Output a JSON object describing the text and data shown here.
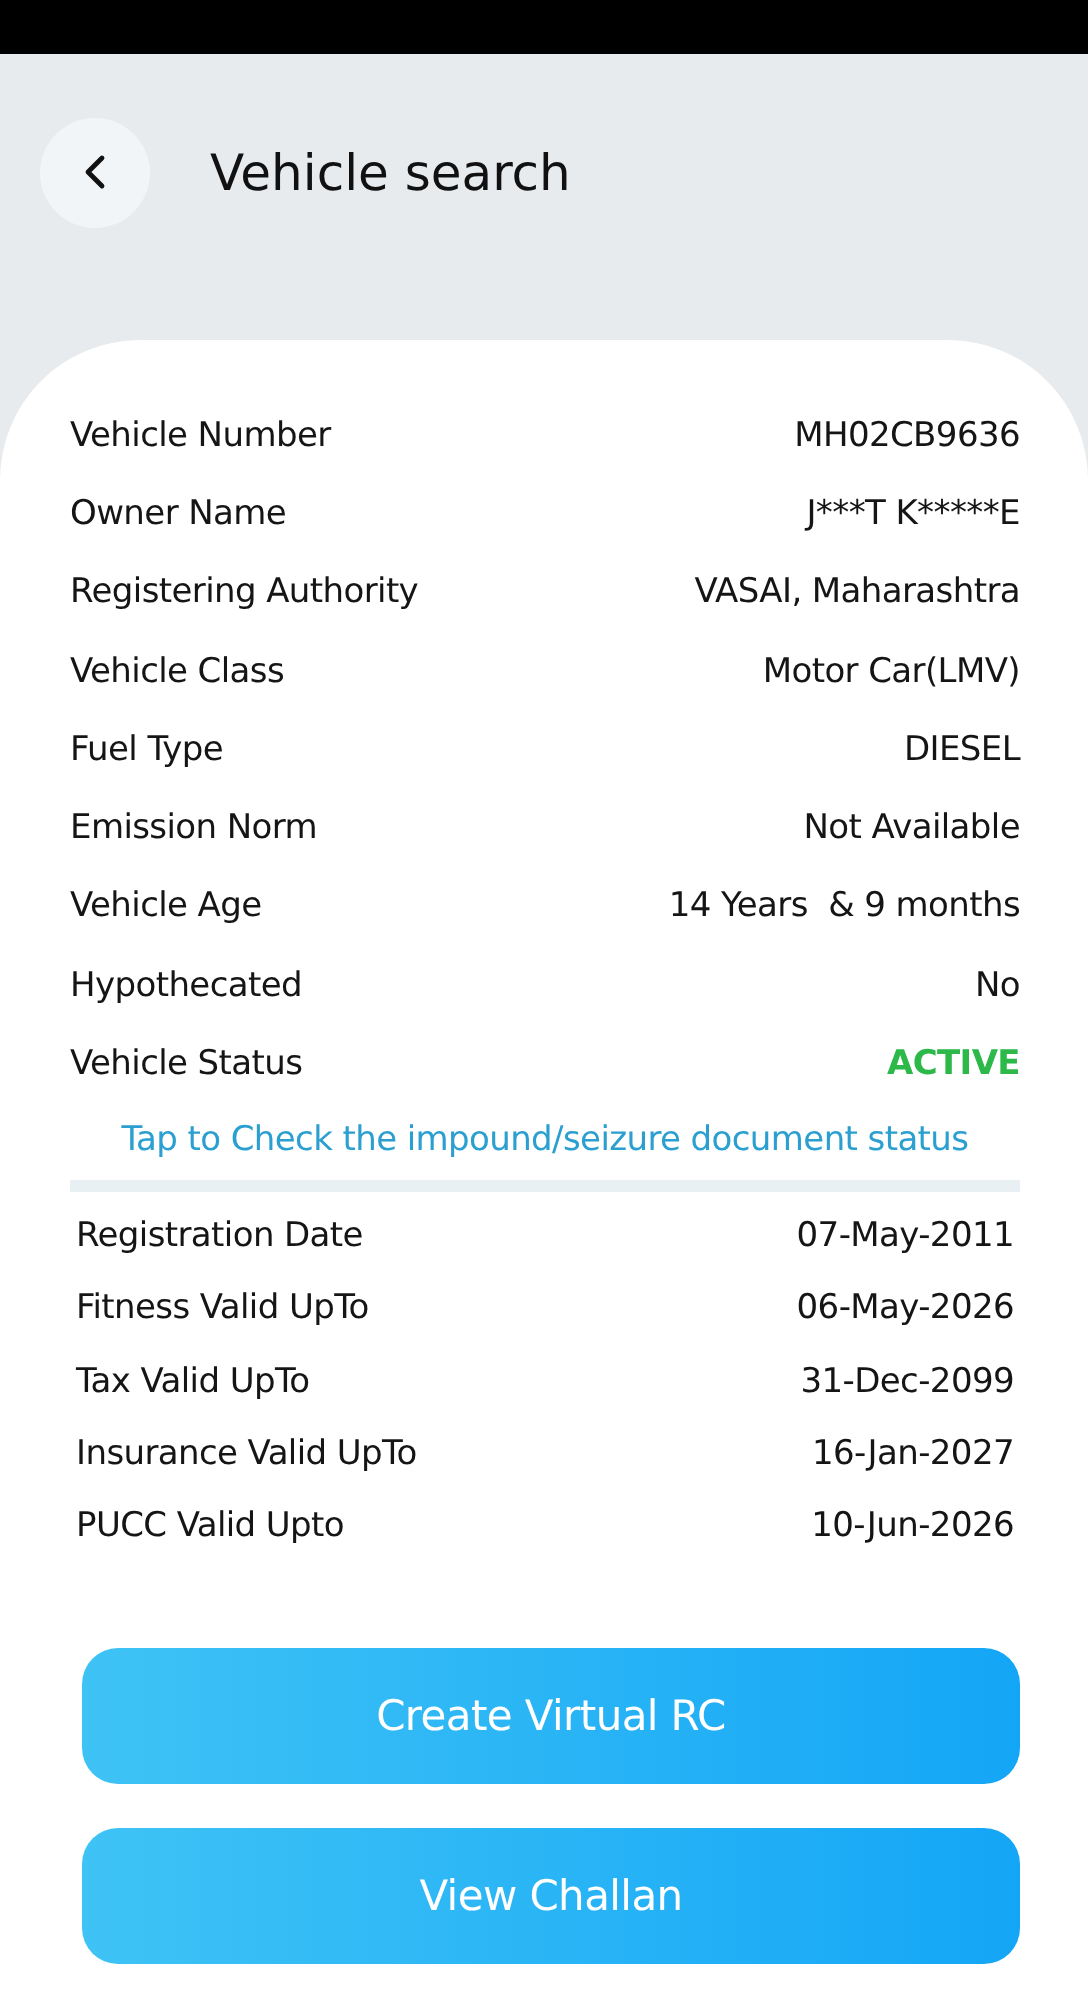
{
  "header": {
    "title": "Vehicle search"
  },
  "details": [
    {
      "label": "Vehicle Number",
      "value": "MH02CB9636"
    },
    {
      "label": "Owner Name",
      "value": "J***T K*****E"
    },
    {
      "label": "Registering Authority",
      "value": "VASAI, Maharashtra"
    },
    {
      "label": "Vehicle Class",
      "value": "Motor Car(LMV)"
    },
    {
      "label": "Fuel Type",
      "value": "DIESEL"
    },
    {
      "label": "Emission Norm",
      "value": "Not Available"
    },
    {
      "label": "Vehicle Age",
      "value": "14 Years  & 9 months"
    },
    {
      "label": "Hypothecated",
      "value": "No"
    },
    {
      "label": "Vehicle Status",
      "value": "ACTIVE",
      "color": "#2db84a"
    }
  ],
  "link": "Tap to Check the impound/seizure document status",
  "dates": [
    {
      "label": "Registration Date",
      "value": "07-May-2011"
    },
    {
      "label": "Fitness Valid UpTo",
      "value": "06-May-2026"
    },
    {
      "label": "Tax Valid UpTo",
      "value": "31-Dec-2099"
    },
    {
      "label": "Insurance Valid UpTo",
      "value": "16-Jan-2027"
    },
    {
      "label": "PUCC Valid Upto",
      "value": "10-Jun-2026"
    }
  ],
  "buttons": [
    "Create Virtual RC",
    "View Challan"
  ]
}
